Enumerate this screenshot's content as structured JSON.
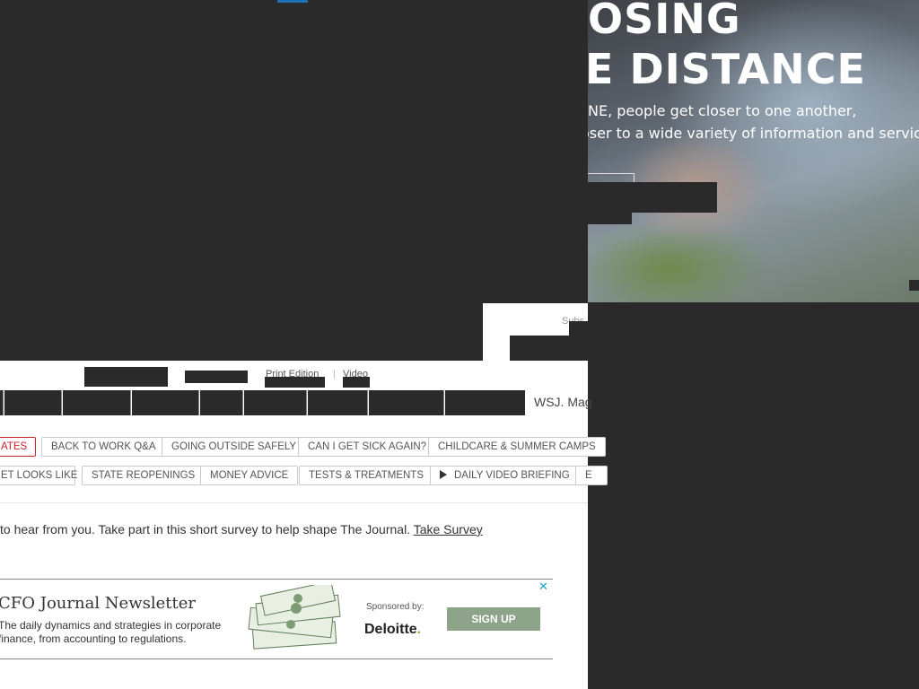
{
  "hero_ad": {
    "headline_line1": "OSING",
    "headline_line2": "E DISTANCE",
    "subline1": "NE, people get closer to one another,",
    "subline2": "oser to a wide variety of information and servic"
  },
  "header": {
    "subscribe_label": "Subs",
    "print_edition": "Print Edition",
    "separator": "|",
    "video": "Video",
    "wsj_mag": "WSJ. Mag"
  },
  "tags": {
    "row1": [
      "ATES",
      "BACK TO WORK Q&A",
      "GOING OUTSIDE SAFELY",
      "CAN I GET SICK AGAIN?",
      "CHILDCARE & SUMMER CAMPS"
    ],
    "row2": [
      "ET LOOKS LIKE",
      "STATE REOPENINGS",
      "MONEY ADVICE",
      "TESTS & TREATMENTS",
      "DAILY VIDEO BRIEFING",
      "E"
    ]
  },
  "survey": {
    "text": "to hear from you. Take part in this short survey to help shape The Journal.",
    "link": "Take Survey"
  },
  "newsletter": {
    "title": "CFO Journal Newsletter",
    "description": "The daily dynamics and strategies in corporate finance, from accounting to regulations.",
    "sponsored_by": "Sponsored by:",
    "sponsor": "Deloitte",
    "sponsor_dot": ".",
    "signup_label": "SIGN UP",
    "close_glyph": "✕"
  },
  "colors": {
    "accent_red": "#c8202b",
    "signup_green": "#8da38a",
    "close_blue": "#19a5c9",
    "top_accent": "#1f6fb5"
  }
}
